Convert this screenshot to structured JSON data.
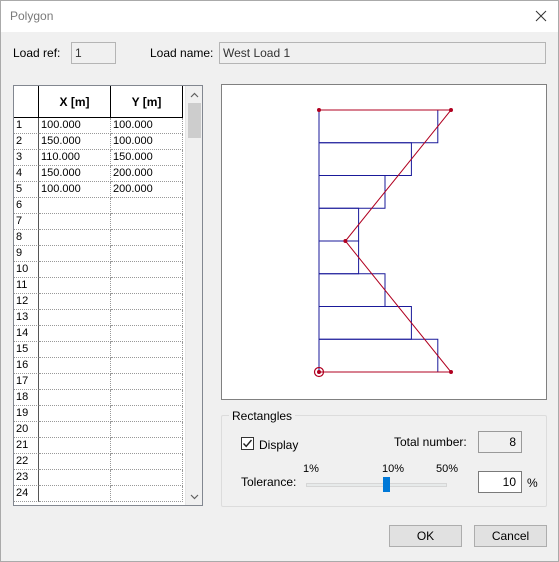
{
  "window": {
    "title": "Polygon"
  },
  "header": {
    "load_ref_label": "Load ref:",
    "load_ref_value": "1",
    "load_name_label": "Load name:",
    "load_name_value": "West Load 1"
  },
  "grid": {
    "columns": [
      "X [m]",
      "Y [m]"
    ],
    "rows": [
      {
        "n": "1",
        "x": "100.000",
        "y": "100.000"
      },
      {
        "n": "2",
        "x": "150.000",
        "y": "100.000"
      },
      {
        "n": "3",
        "x": "110.000",
        "y": "150.000"
      },
      {
        "n": "4",
        "x": "150.000",
        "y": "200.000"
      },
      {
        "n": "5",
        "x": "100.000",
        "y": "200.000"
      },
      {
        "n": "6",
        "x": "",
        "y": ""
      },
      {
        "n": "7",
        "x": "",
        "y": ""
      },
      {
        "n": "8",
        "x": "",
        "y": ""
      },
      {
        "n": "9",
        "x": "",
        "y": ""
      },
      {
        "n": "10",
        "x": "",
        "y": ""
      },
      {
        "n": "11",
        "x": "",
        "y": ""
      },
      {
        "n": "12",
        "x": "",
        "y": ""
      },
      {
        "n": "13",
        "x": "",
        "y": ""
      },
      {
        "n": "14",
        "x": "",
        "y": ""
      },
      {
        "n": "15",
        "x": "",
        "y": ""
      },
      {
        "n": "16",
        "x": "",
        "y": ""
      },
      {
        "n": "17",
        "x": "",
        "y": ""
      },
      {
        "n": "18",
        "x": "",
        "y": ""
      },
      {
        "n": "19",
        "x": "",
        "y": ""
      },
      {
        "n": "20",
        "x": "",
        "y": ""
      },
      {
        "n": "21",
        "x": "",
        "y": ""
      },
      {
        "n": "22",
        "x": "",
        "y": ""
      },
      {
        "n": "23",
        "x": "",
        "y": ""
      },
      {
        "n": "24",
        "x": "",
        "y": ""
      }
    ]
  },
  "polygon_points": [
    [
      100,
      100
    ],
    [
      150,
      100
    ],
    [
      110,
      150
    ],
    [
      150,
      200
    ],
    [
      100,
      200
    ]
  ],
  "rectangles": {
    "group_label": "Rectangles",
    "display_label": "Display",
    "display_checked": true,
    "total_label": "Total number:",
    "total_value": "8",
    "tolerance_label": "Tolerance:",
    "ticks": [
      "1%",
      "10%",
      "50%"
    ],
    "tolerance_value": "10",
    "unit": "%"
  },
  "buttons": {
    "ok": "OK",
    "cancel": "Cancel"
  },
  "colors": {
    "polygon": "#b00020",
    "rectangles": "#1a1a9a",
    "accent": "#0078d7"
  }
}
